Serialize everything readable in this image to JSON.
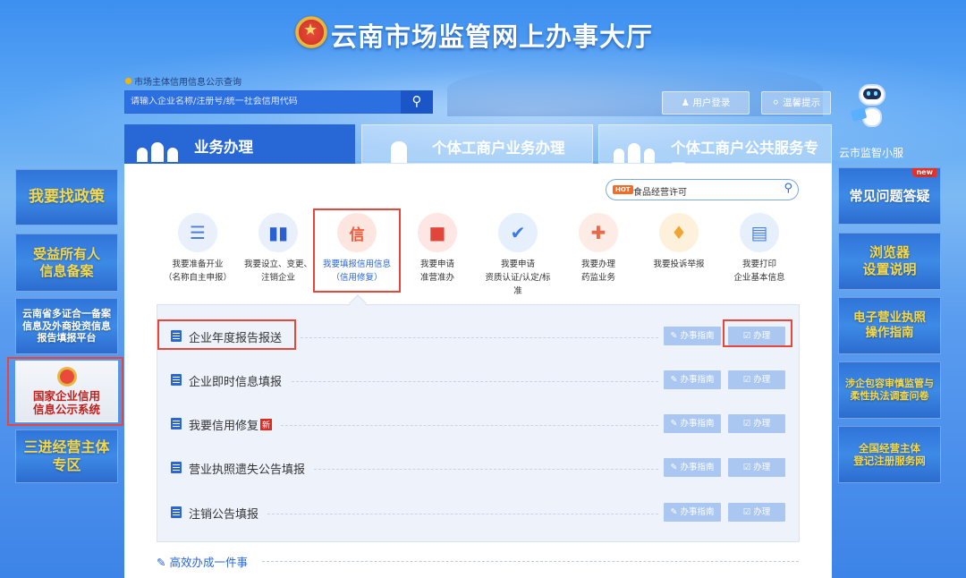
{
  "header": {
    "title": "云南市场监管网上办事大厅"
  },
  "search": {
    "hint": "市场主体信用信息公示查询",
    "placeholder": "请输入企业名称/注册号/统一社会信用代码"
  },
  "top_buttons": {
    "login": "用户登录",
    "tips": "温馨提示"
  },
  "assistant": {
    "label": "云市监智小服"
  },
  "tabs": [
    {
      "label": "业务办理",
      "active": true
    },
    {
      "label": "个体工商户业务办理",
      "active": false
    },
    {
      "label": "个体工商户公共服务专区",
      "active": false
    }
  ],
  "panel_search": {
    "hot": "HOT",
    "value": "食品经营许可"
  },
  "services": [
    {
      "label": "我要准备开业（名称自主申报）",
      "line1": "我要准备开业",
      "line2": "（名称自主申报）",
      "icon": "clipboard-icon",
      "color": "#5b8fe8"
    },
    {
      "label": "我要设立、变更、注销企业",
      "line1": "我要设立、变更、",
      "line2": "注销企业",
      "icon": "binder-icon",
      "color": "#2a5fd0"
    },
    {
      "label": "我要填报信用信息（信用修复）",
      "line1": "我要填报信用信息",
      "line2": "（信用修复）",
      "icon": "credit-icon",
      "color": "#ef5a3b",
      "active": true
    },
    {
      "label": "我要申请准营准办",
      "line1": "我要申请",
      "line2": "准营准办",
      "icon": "stamp-icon",
      "color": "#e2453a"
    },
    {
      "label": "我要申请资质认证/认定/标准",
      "line1": "我要申请",
      "line2": "资质认证/认定/标",
      "line3": "准",
      "icon": "shield-check-icon",
      "color": "#3b7ae8"
    },
    {
      "label": "我要办理药监业务",
      "line1": "我要办理",
      "line2": "药监业务",
      "icon": "medicine-icon",
      "color": "#e86a4a"
    },
    {
      "label": "我要投诉举报",
      "line1": "我要投诉举报",
      "line2": "",
      "icon": "megaphone-icon",
      "color": "#f0a434"
    },
    {
      "label": "我要打印企业基本信息",
      "line1": "我要打印",
      "line2": "企业基本信息",
      "icon": "printer-icon",
      "color": "#4a84e0"
    }
  ],
  "list": {
    "guide_label": "办事指南",
    "do_label": "办理",
    "items": [
      {
        "title": "企业年度报告报送",
        "new": false
      },
      {
        "title": "企业即时信息填报",
        "new": false
      },
      {
        "title": "我要信用修复",
        "new": true,
        "new_label": "新"
      },
      {
        "title": "营业执照遗失公告填报",
        "new": false
      },
      {
        "title": "注销公告填报",
        "new": false
      }
    ]
  },
  "footer": {
    "link": "高效办成一件事"
  },
  "left_banners": [
    {
      "text": "我要找政策"
    },
    {
      "text": "受益所有人\n信息备案"
    },
    {
      "text": "云南省多证合一备案\n信息及外商投资信息\n报告填报平台"
    },
    {
      "text": "国家企业信用\n信息公示系统"
    },
    {
      "text": "三进经营主体\n专区"
    }
  ],
  "right_banners": [
    {
      "text": "常见问题答疑",
      "new_tag": "new"
    },
    {
      "text": "浏览器\n设置说明"
    },
    {
      "text": "电子营业执照\n操作指南"
    },
    {
      "text": "涉企包容审慎监管与\n柔性执法调查问卷"
    },
    {
      "text": "全国经营主体\n登记注册服务网"
    }
  ],
  "colors": {
    "accent": "#2a66d4",
    "highlight": "#e8463a",
    "banner_text": "#f5d84a"
  }
}
